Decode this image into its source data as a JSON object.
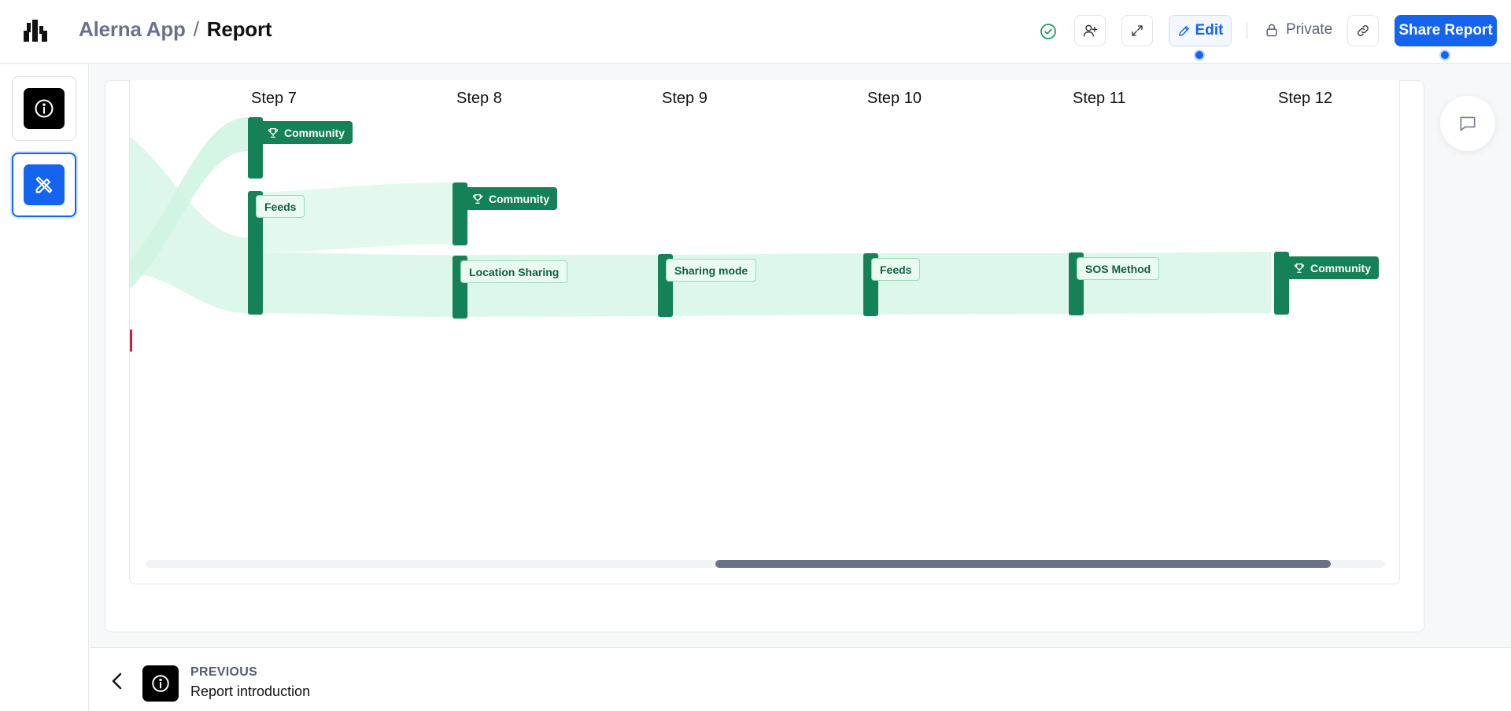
{
  "header": {
    "app_name": "Alerna App",
    "separator": "/",
    "page_title": "Report",
    "edit_label": "Edit",
    "private_label": "Private",
    "share_label": "Share Report"
  },
  "sidebar": {
    "items": [
      {
        "name": "info",
        "icon": "info-icon",
        "active": false
      },
      {
        "name": "design",
        "icon": "pencil-ruler-icon",
        "active": true
      }
    ]
  },
  "chart_data": {
    "type": "sankey",
    "steps": [
      "Step 7",
      "Step 8",
      "Step 9",
      "Step 10",
      "Step 11",
      "Step 12"
    ],
    "nodes": [
      {
        "step": "Step 7",
        "label": "Community",
        "goal": true
      },
      {
        "step": "Step 7",
        "label": "Feeds",
        "goal": false
      },
      {
        "step": "Step 8",
        "label": "Community",
        "goal": true
      },
      {
        "step": "Step 8",
        "label": "Location Sharing",
        "goal": false
      },
      {
        "step": "Step 9",
        "label": "Sharing mode",
        "goal": false
      },
      {
        "step": "Step 10",
        "label": "Feeds",
        "goal": false
      },
      {
        "step": "Step 11",
        "label": "SOS Method",
        "goal": false
      },
      {
        "step": "Step 12",
        "label": "Community",
        "goal": true
      }
    ],
    "colors": {
      "node": "#148157",
      "flow": "#ddf8ea",
      "goal_label": "#148157"
    }
  },
  "footer": {
    "kicker": "PREVIOUS",
    "title": "Report introduction"
  }
}
